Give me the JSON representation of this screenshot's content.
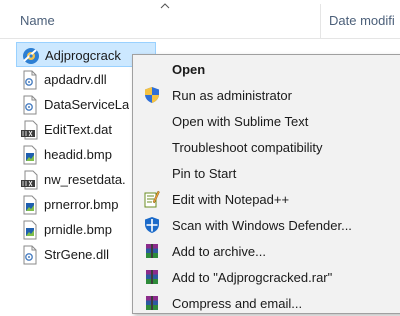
{
  "header": {
    "name_column": "Name",
    "date_column": "Date modifi"
  },
  "files": [
    {
      "name": "Adjprogcrack",
      "icon": "app-gear-icon",
      "selected": true
    },
    {
      "name": "apdadrv.dll",
      "icon": "dll-file-icon"
    },
    {
      "name": "DataServiceLa",
      "icon": "dll-file-icon"
    },
    {
      "name": "EditText.dat",
      "icon": "dat-file-icon"
    },
    {
      "name": "headid.bmp",
      "icon": "bitmap-file-icon"
    },
    {
      "name": "nw_resetdata.",
      "icon": "dat-file-icon"
    },
    {
      "name": "prnerror.bmp",
      "icon": "bitmap-file-icon"
    },
    {
      "name": "prnidle.bmp",
      "icon": "bitmap-file-icon"
    },
    {
      "name": "StrGene.dll",
      "icon": "dll-file-icon"
    }
  ],
  "context_menu": {
    "items": [
      {
        "label": "Open",
        "icon": "",
        "bold": true
      },
      {
        "label": "Run as administrator",
        "icon": "uac-shield-icon"
      },
      {
        "label": "Open with Sublime Text",
        "icon": ""
      },
      {
        "label": "Troubleshoot compatibility",
        "icon": ""
      },
      {
        "label": "Pin to Start",
        "icon": ""
      },
      {
        "label": "Edit with Notepad++",
        "icon": "notepad-plus-icon"
      },
      {
        "label": "Scan with Windows Defender...",
        "icon": "defender-icon"
      },
      {
        "label": "Add to archive...",
        "icon": "winrar-icon"
      },
      {
        "label": "Add to \"Adjprogcracked.rar\"",
        "icon": "winrar-icon"
      },
      {
        "label": "Compress and email...",
        "icon": "winrar-icon"
      }
    ]
  },
  "colors": {
    "selection_fill": "#cce8ff",
    "selection_border": "#99d1ff",
    "menu_background": "#f2f2f2",
    "header_text": "#4c607a"
  }
}
